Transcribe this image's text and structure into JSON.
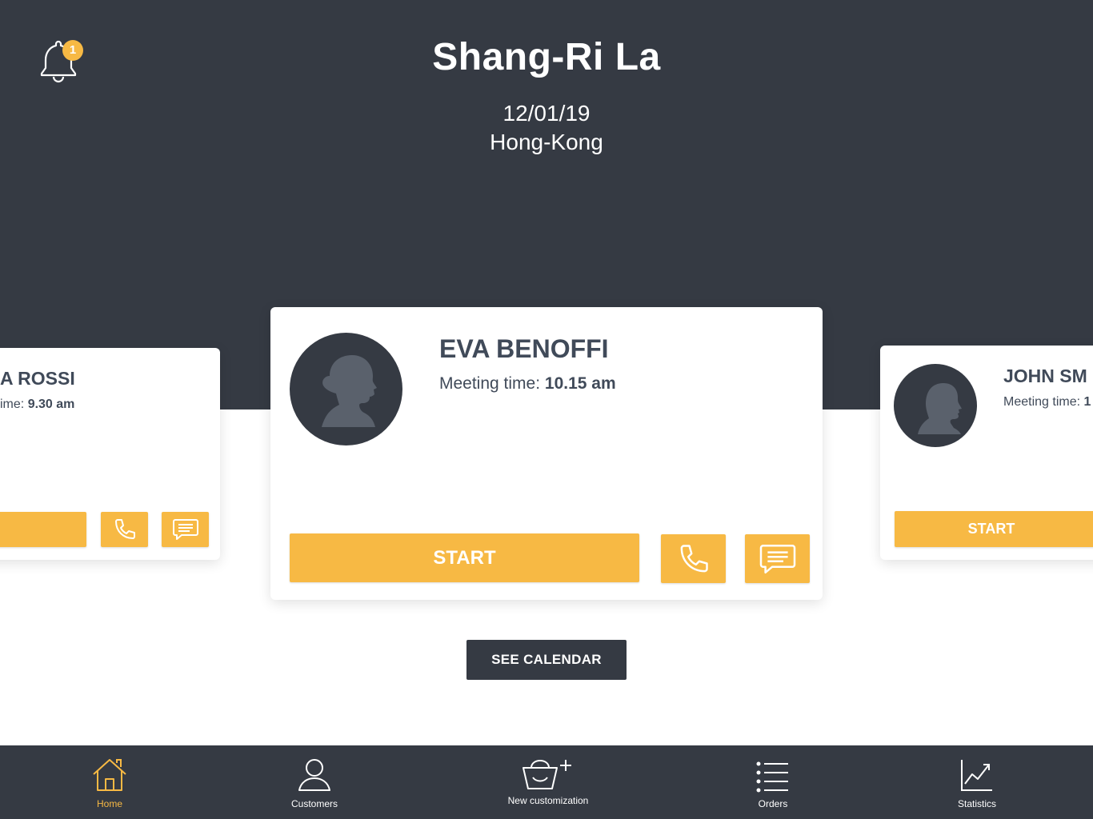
{
  "header": {
    "title": "Shang-Ri La",
    "date": "12/01/19",
    "location": "Hong-Kong",
    "notification_count": "1"
  },
  "cards": {
    "left": {
      "name": "A ROSSI",
      "meeting_label": "ime:",
      "meeting_time": "9.30 am"
    },
    "main": {
      "name": "EVA BENOFFI",
      "meeting_label": "Meeting time:",
      "meeting_time": "10.15 am",
      "start_label": "START"
    },
    "right": {
      "name": "JOHN SM",
      "meeting_label": "Meeting time:",
      "meeting_time": "1",
      "start_label": "START"
    }
  },
  "see_calendar_label": "SEE CALENDAR",
  "tabbar": {
    "items": [
      {
        "label": "Home",
        "icon": "home-icon",
        "active": true
      },
      {
        "label": "Customers",
        "icon": "user-icon",
        "active": false
      },
      {
        "label": "New customization",
        "icon": "bag-plus-icon",
        "active": false
      },
      {
        "label": "Orders",
        "icon": "list-icon",
        "active": false
      },
      {
        "label": "Statistics",
        "icon": "chart-icon",
        "active": false
      }
    ]
  },
  "colors": {
    "dark": "#353a43",
    "accent": "#f7b944",
    "text": "#404a59"
  }
}
